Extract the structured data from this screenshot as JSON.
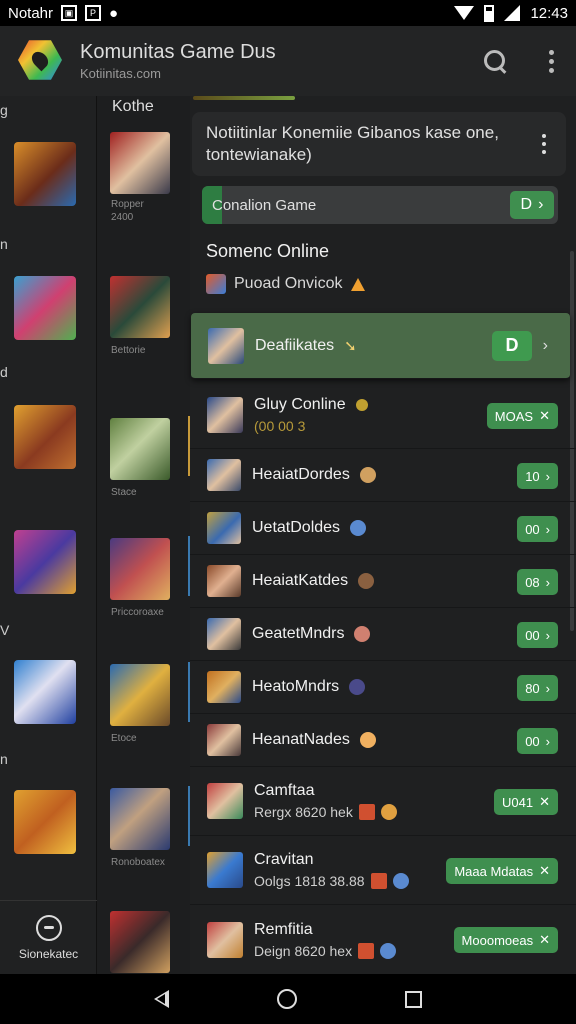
{
  "status_bar": {
    "app_name": "Notahr",
    "time": "12:43"
  },
  "app_bar": {
    "title": "Komunitas Game Dus",
    "subtitle": "Kotiinitas.com"
  },
  "left_column": {
    "labels": [
      "g",
      "n",
      "d",
      "V",
      "n"
    ],
    "bottom_label": "Sionekatec"
  },
  "middle_column": {
    "header": "Kothe",
    "captions": [
      "Ropper\n2400",
      "Bettorie",
      "Stace",
      "Priccoroaxe",
      "Etoce",
      "Ronoboatex"
    ]
  },
  "notification": {
    "text": "Notiitinlar Konemiie Gibanos kase one, tontewianake)"
  },
  "campaign": {
    "label": "Conalion Game",
    "button": "D"
  },
  "section": {
    "title": "Somenc Online",
    "subtitle": "Puoad Onvicok"
  },
  "rows": [
    {
      "name": "Deafiikates",
      "sub": "",
      "button": "D"
    },
    {
      "name": "Gluy Conline",
      "sub": "(00 00 3",
      "button": "MOAS"
    },
    {
      "name": "HeaiatDordes",
      "sub": "",
      "button": "10"
    },
    {
      "name": "UetatDoldes",
      "sub": "",
      "button": "00"
    },
    {
      "name": "HeaiatKatdes",
      "sub": "",
      "button": "08"
    },
    {
      "name": "GeatetMndrs",
      "sub": "",
      "button": "00"
    },
    {
      "name": "HeatoMndrs",
      "sub": "",
      "button": "80"
    },
    {
      "name": "HeanatNades",
      "sub": "",
      "button": "00"
    },
    {
      "name": "Camftaa",
      "sub": "Rergx 8620 hek",
      "button": "U041"
    },
    {
      "name": "Cravitan",
      "sub": "Oolgs 1818 38.88",
      "button": "Maaa Mdatas"
    },
    {
      "name": "Remfitia",
      "sub": "Deign 8620 hex",
      "button": "Mooomoeas"
    }
  ],
  "colors": {
    "accent": "#3f8f4f",
    "highlight": "#4a6a48",
    "background": "#1b1c1d"
  },
  "icons": [
    "search-icon",
    "more-vert-icon",
    "back-icon",
    "home-icon",
    "recents-icon"
  ]
}
